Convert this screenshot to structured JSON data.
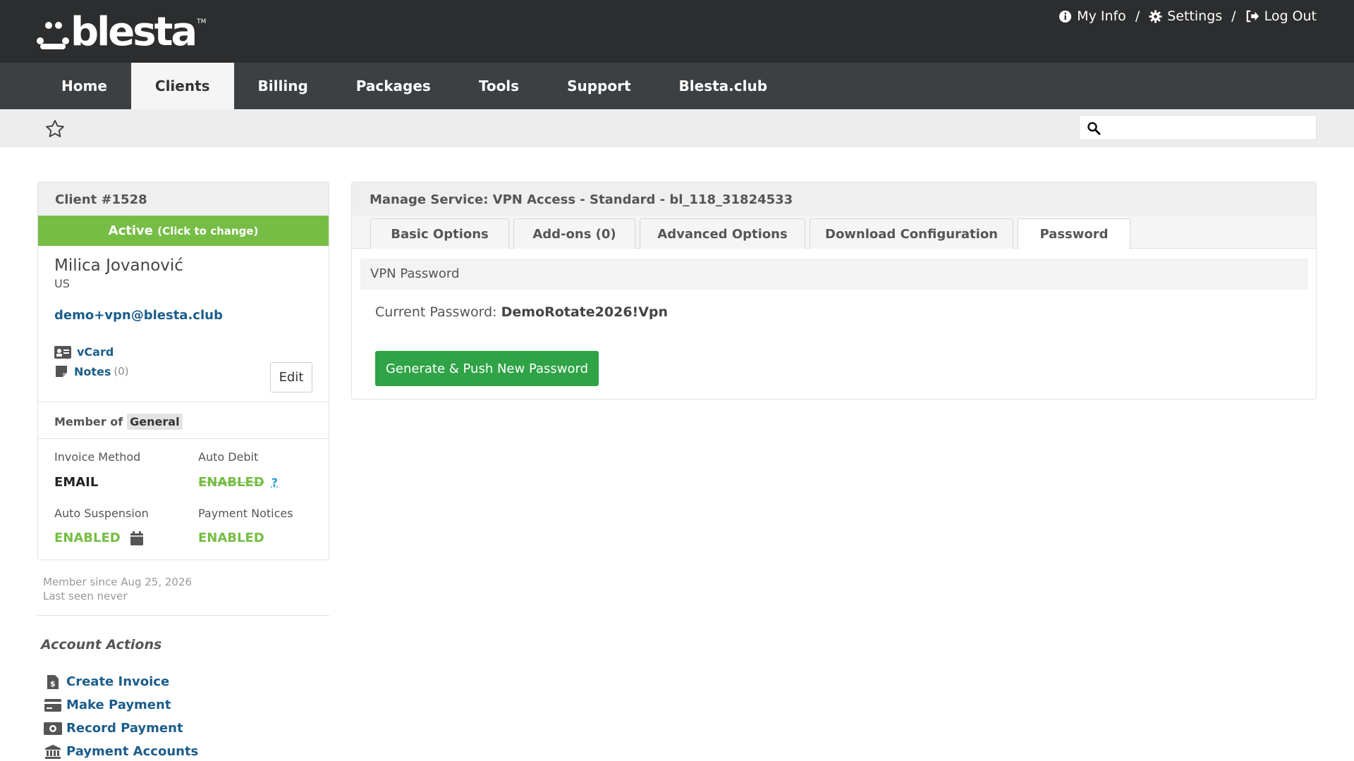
{
  "brand": {
    "name": "blesta",
    "tm": "TM"
  },
  "top_links": {
    "my_info": "My Info",
    "settings": "Settings",
    "logout": "Log Out",
    "sep": "/"
  },
  "nav": {
    "items": [
      "Home",
      "Clients",
      "Billing",
      "Packages",
      "Tools",
      "Support",
      "Blesta.club"
    ],
    "active": "Clients"
  },
  "search": {
    "placeholder": "",
    "value": ""
  },
  "client": {
    "title": "Client #1528",
    "status": "Active",
    "status_hint": "(Click to change)",
    "name": "Milica Jovanović",
    "country": "US",
    "email": "demo+vpn@blesta.club",
    "vcard": "vCard",
    "notes": "Notes",
    "notes_count": "(0)",
    "edit": "Edit",
    "member_of": "Member of",
    "group": "General",
    "invoice_method_label": "Invoice Method",
    "invoice_method": "EMAIL",
    "auto_debit_label": "Auto Debit",
    "auto_debit": "ENABLED",
    "auto_debit_help": "?",
    "auto_suspension_label": "Auto Suspension",
    "auto_suspension": "ENABLED",
    "payment_notices_label": "Payment Notices",
    "payment_notices": "ENABLED",
    "member_since": "Member since Aug 25, 2026",
    "last_seen": "Last seen never"
  },
  "account_actions": {
    "title": "Account Actions",
    "items": [
      "Create Invoice",
      "Make Payment",
      "Record Payment",
      "Payment Accounts"
    ]
  },
  "service": {
    "title": "Manage Service: VPN Access - Standard - bl_118_31824533",
    "tabs": [
      "Basic Options",
      "Add-ons (0)",
      "Advanced Options",
      "Download Configuration",
      "Password"
    ],
    "active_tab": "Password",
    "section": "VPN Password",
    "current_password_label": "Current Password:",
    "current_password": "DemoRotate2026!Vpn",
    "generate_button": "Generate & Push New Password"
  },
  "colors": {
    "header": "#2b2d2e",
    "nav": "#3c4043",
    "active_green": "#76bd45",
    "button_green": "#2fa346",
    "link": "#1b5d8b"
  }
}
